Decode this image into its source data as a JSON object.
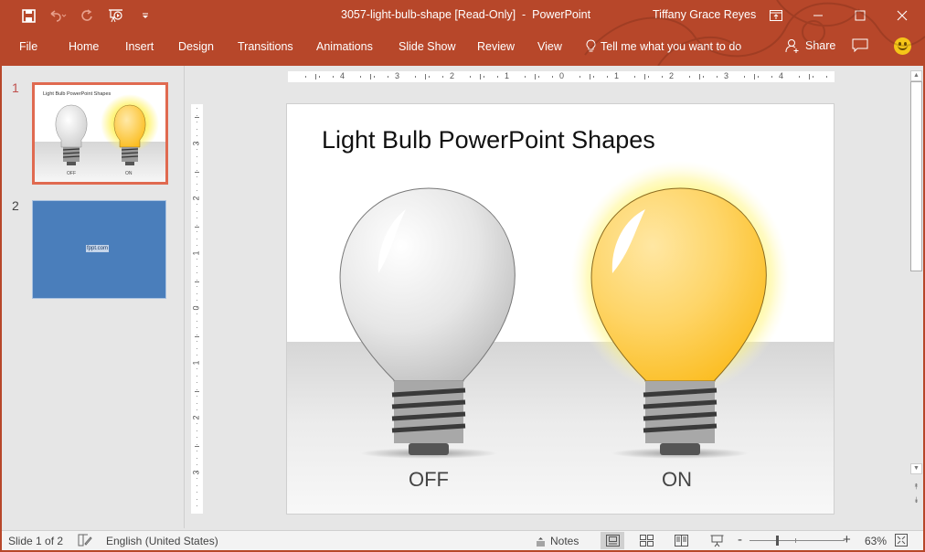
{
  "titlebar": {
    "document_title": "3057-light-bulb-shape [Read-Only]  -  PowerPoint",
    "user_name": "Tiffany Grace Reyes",
    "quick_access": [
      "save-icon",
      "undo-icon",
      "redo-icon",
      "start-from-beginning-icon",
      "customize-qat-icon"
    ],
    "window_controls": [
      "ribbon-display-options-icon",
      "minimize-icon",
      "maximize-icon",
      "close-icon"
    ]
  },
  "ribbon": {
    "tabs": [
      {
        "label": "File"
      },
      {
        "label": "Home"
      },
      {
        "label": "Insert"
      },
      {
        "label": "Design"
      },
      {
        "label": "Transitions"
      },
      {
        "label": "Animations"
      },
      {
        "label": "Slide Show"
      },
      {
        "label": "Review"
      },
      {
        "label": "View"
      }
    ],
    "tell_me": "Tell me what you want to do",
    "share": "Share"
  },
  "thumbnails": [
    {
      "number": "1",
      "title": "Light Bulb PowerPoint Shapes",
      "labels": [
        "OFF",
        "ON"
      ],
      "selected": true
    },
    {
      "number": "2",
      "text": "fppt.com",
      "selected": false
    }
  ],
  "rulers": {
    "horizontal": [
      "4",
      "3",
      "2",
      "1",
      "0",
      "1",
      "2",
      "3",
      "4"
    ],
    "vertical": [
      "3",
      "2",
      "1",
      "0",
      "1",
      "2",
      "3"
    ]
  },
  "slide": {
    "title": "Light Bulb PowerPoint Shapes",
    "bulbs": [
      {
        "label": "OFF",
        "state": "off",
        "color": "#e8e8e8"
      },
      {
        "label": "ON",
        "state": "on",
        "color": "#fdc93a"
      }
    ]
  },
  "statusbar": {
    "slide_info": "Slide 1 of 2",
    "language": "English (United States)",
    "notes": "Notes",
    "zoom": "63%"
  },
  "colors": {
    "accent": "#b7472a",
    "thumb_selected_border": "#e06a50",
    "slide2_bg": "#4a7ebb"
  }
}
